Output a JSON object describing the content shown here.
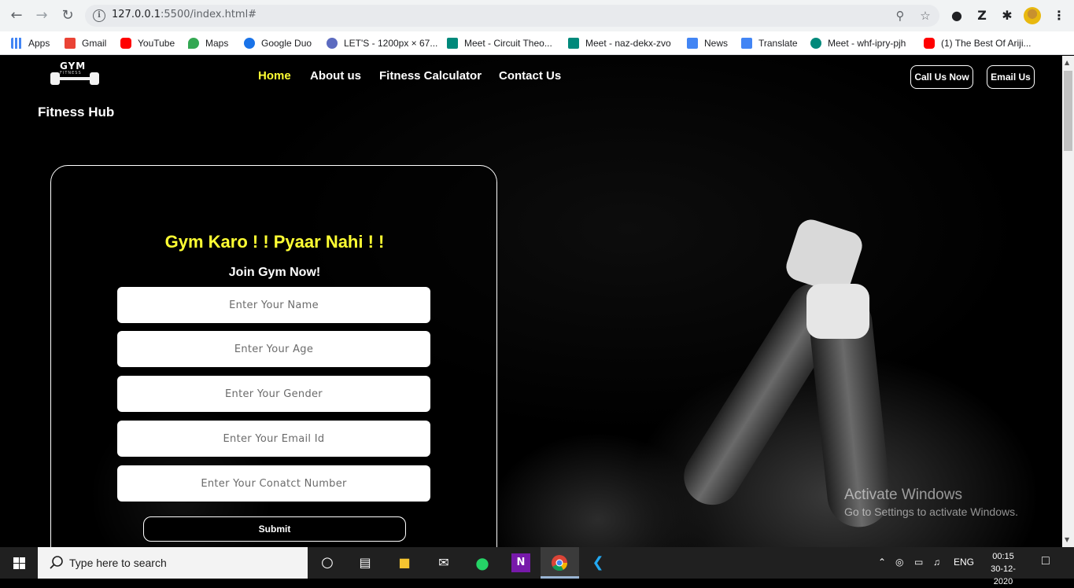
{
  "browser": {
    "url_main": "127.0.0.1",
    "url_rest": ":5500/index.html#",
    "ext_z": "Z",
    "bookmarks": [
      {
        "label": "Apps",
        "color": "#4285f4"
      },
      {
        "label": "Gmail",
        "color": "#ea4335"
      },
      {
        "label": "YouTube",
        "color": "#ff0000"
      },
      {
        "label": "Maps",
        "color": "#34a853"
      },
      {
        "label": "Google Duo",
        "color": "#1a73e8"
      },
      {
        "label": "LET'S - 1200px × 67...",
        "color": "#5c6bc0"
      },
      {
        "label": "Meet - Circuit Theo...",
        "color": "#00897b"
      },
      {
        "label": "Meet - naz-dekx-zvo",
        "color": "#00897b"
      },
      {
        "label": "News",
        "color": "#4285f4"
      },
      {
        "label": "Translate",
        "color": "#4285f4"
      },
      {
        "label": "Meet - whf-ipry-pjh",
        "color": "#00897b"
      },
      {
        "label": "(1) The Best Of Ariji...",
        "color": "#ff0000"
      }
    ]
  },
  "site": {
    "logo_text": "GYM",
    "logo_sub": "FITNESS",
    "nav": {
      "home": "Home",
      "about": "About us",
      "calculator": "Fitness Calculator",
      "contact": "Contact Us"
    },
    "call_button": "Call Us Now",
    "email_button": "Email Us",
    "brand": "Fitness Hub",
    "accent_color": "#ffff33"
  },
  "form": {
    "title": "Gym Karo ! ! Pyaar Nahi ! !",
    "subtitle": "Join Gym Now!",
    "name_placeholder": "Enter Your Name",
    "age_placeholder": "Enter Your Age",
    "gender_placeholder": "Enter Your Gender",
    "email_placeholder": "Enter Your Email Id",
    "contact_placeholder": "Enter Your Conatct Number",
    "submit_label": "Submit"
  },
  "watermark": {
    "line1": "Activate Windows",
    "line2": "Go to Settings to activate Windows."
  },
  "taskbar": {
    "search_text": "Type here to search",
    "lang": "ENG",
    "time": "00:15",
    "date": "30-12-2020"
  }
}
